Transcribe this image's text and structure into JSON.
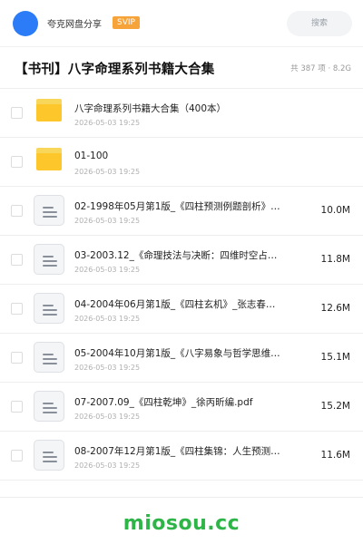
{
  "header": {
    "user_name": "夸克网盘分享",
    "badge": "SVIP",
    "search_placeholder": "搜索",
    "accent_color": "#2b7cf6"
  },
  "page": {
    "title": "【书刊】八字命理系列书籍大合集",
    "summary": "共 387 项 · 8.2G"
  },
  "files": [
    {
      "type": "folder",
      "name": "八字命理系列书籍大合集（400本）",
      "date": "2026-05-03 19:25",
      "size": ""
    },
    {
      "type": "folder",
      "name": "01-100",
      "date": "2026-05-03 19:25",
      "size": ""
    },
    {
      "type": "file",
      "name": "02-1998年05月第1版_《四柱预测例题剖析》…",
      "date": "2026-05-03 19:25",
      "size": "10.0M"
    },
    {
      "type": "file",
      "name": "03-2003.12_《命理技法与决断：四维时空占…",
      "date": "2026-05-03 19:25",
      "size": "11.8M"
    },
    {
      "type": "file",
      "name": "04-2004年06月第1版_《四柱玄机》_张志春…",
      "date": "2026-05-03 19:25",
      "size": "12.6M"
    },
    {
      "type": "file",
      "name": "05-2004年10月第1版_《八字易象与哲学思维…",
      "date": "2026-05-03 19:25",
      "size": "15.1M"
    },
    {
      "type": "file",
      "name": "07-2007.09_《四柱乾坤》_徐丙昕编.pdf",
      "date": "2026-05-03 19:25",
      "size": "15.2M"
    },
    {
      "type": "file",
      "name": "08-2007年12月第1版_《四柱集锦：人生预测…",
      "date": "2026-05-03 19:25",
      "size": "11.6M"
    }
  ],
  "watermark": "miosou.cc"
}
